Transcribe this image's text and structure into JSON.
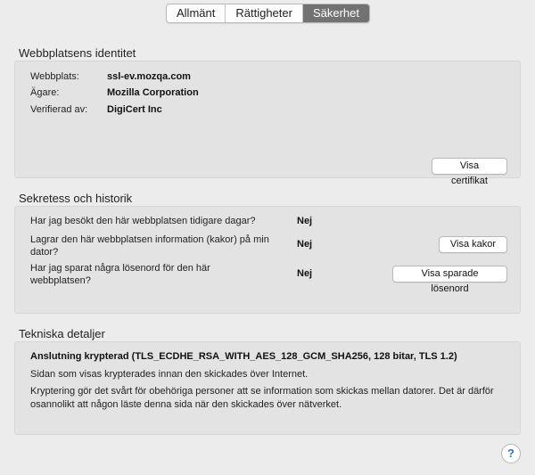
{
  "tabs": [
    {
      "label": "Allmänt"
    },
    {
      "label": "Rättigheter"
    },
    {
      "label": "Säkerhet"
    }
  ],
  "identity": {
    "title": "Webbplatsens identitet",
    "website_label": "Webbplats:",
    "website_value": "ssl-ev.mozqa.com",
    "owner_label": "Ägare:",
    "owner_value": "Mozilla Corporation",
    "verified_label": "Verifierad av:",
    "verified_value": "DigiCert Inc",
    "view_cert_button": "Visa certifikat"
  },
  "privacy": {
    "title": "Sekretess och historik",
    "q1": "Har jag besökt den här webbplatsen tidigare dagar?",
    "a1": "Nej",
    "q2": "Lagrar den här webbplatsen information (kakor) på min dator?",
    "a2": "Nej",
    "cookies_button": "Visa kakor",
    "q3": "Har jag sparat några lösenord för den här webbplatsen?",
    "a3": "Nej",
    "passwords_button": "Visa sparade lösenord"
  },
  "technical": {
    "title": "Tekniska detaljer",
    "connection": "Anslutning krypterad (TLS_ECDHE_RSA_WITH_AES_128_GCM_SHA256, 128 bitar, TLS 1.2)",
    "line1": "Sidan som visas krypterades innan den skickades över Internet.",
    "line2": "Kryptering gör det svårt för obehöriga personer att se information som skickas mellan datorer. Det är därför osannolikt att någon läste denna sida när den skickades över nätverket."
  },
  "help": {
    "symbol": "?"
  }
}
